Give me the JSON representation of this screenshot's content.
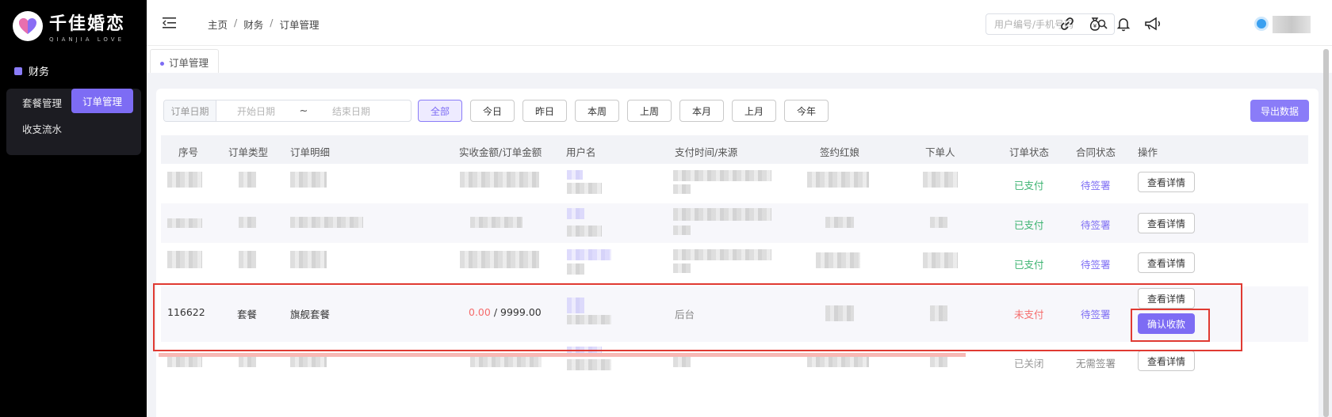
{
  "sidebar": {
    "brand": {
      "title": "千佳婚恋",
      "subtitle": "QIANJIA LOVE",
      "icon": "heart-logo-icon"
    },
    "group": {
      "label": "财务",
      "icon": "wallet-icon"
    },
    "items": [
      {
        "label": "套餐管理",
        "active": false
      },
      {
        "label": "订单管理",
        "active": true
      },
      {
        "label": "收支流水",
        "active": false
      }
    ]
  },
  "header": {
    "breadcrumb": [
      "主页",
      "财务",
      "订单管理"
    ],
    "search_placeholder": "用户编号/手机号码",
    "icons": [
      "link-icon",
      "money-bag-icon",
      "bell-icon",
      "megaphone-icon"
    ]
  },
  "tabs": [
    {
      "label": "订单管理"
    }
  ],
  "filter": {
    "date_label": "订单日期",
    "start_placeholder": "开始日期",
    "tilde": "~",
    "end_placeholder": "结束日期",
    "buttons": [
      "全部",
      "今日",
      "昨日",
      "本周",
      "上周",
      "本月",
      "上月",
      "今年"
    ],
    "active": "全部",
    "export_label": "导出数据"
  },
  "table": {
    "headers": [
      "序号",
      "订单类型",
      "订单明细",
      "实收金额/订单金额",
      "用户名",
      "支付时间/来源",
      "签约红娘",
      "下单人",
      "订单状态",
      "合同状态",
      "操作"
    ],
    "rows": [
      {
        "status": "已支付",
        "contract": "待签署",
        "actions": [
          "查看详情"
        ]
      },
      {
        "status": "已支付",
        "contract": "待签署",
        "actions": [
          "查看详情"
        ]
      },
      {
        "status": "已支付",
        "contract": "待签署",
        "actions": [
          "查看详情"
        ]
      },
      {
        "id": "116622",
        "type": "套餐",
        "detail": "旗舰套餐",
        "paid": "0.00",
        "sep": "/",
        "total": "9999.00",
        "source": "后台",
        "status": "未支付",
        "contract": "待签署",
        "actions": [
          "查看详情",
          "确认收款"
        ]
      },
      {
        "status": "已关闭",
        "contract": "无需签署",
        "actions": [
          "查看详情"
        ]
      }
    ]
  },
  "colors": {
    "accent": "#7d6cf4",
    "paid": "#3cb371",
    "unpaid": "#f56c6c",
    "highlight": "#e03a32"
  }
}
